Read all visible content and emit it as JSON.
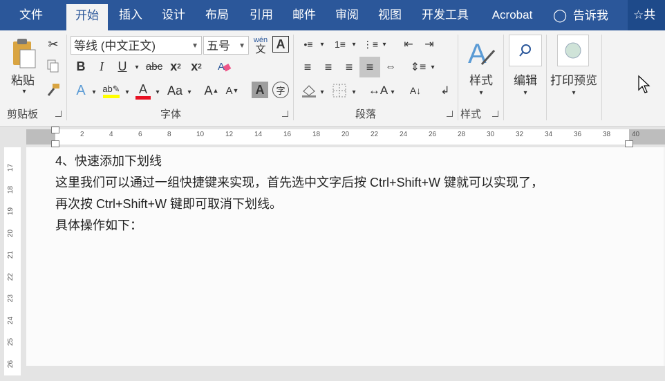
{
  "tabs": [
    "文件",
    "开始",
    "插入",
    "设计",
    "布局",
    "引用",
    "邮件",
    "审阅",
    "视图",
    "开发工具",
    "Acrobat"
  ],
  "active_tab": "开始",
  "tellme": "告诉我",
  "share_label": "共",
  "clipboard": {
    "paste": "粘贴",
    "group": "剪贴板"
  },
  "font": {
    "name": "等线 (中文正文)",
    "size": "五号",
    "wen_top": "wén",
    "wen_bottom": "文",
    "group": "字体",
    "aa": "Aa"
  },
  "paragraph": {
    "group": "段落"
  },
  "styles": {
    "label": "样式",
    "group": "样式"
  },
  "editing": {
    "label": "编辑"
  },
  "print_preview": {
    "label": "打印预览"
  },
  "ruler": {
    "h_numbers": [
      "2",
      "4",
      "6",
      "8",
      "10",
      "12",
      "14",
      "16",
      "18",
      "20",
      "22",
      "24",
      "26",
      "28",
      "30",
      "32",
      "34",
      "36",
      "38",
      "40"
    ],
    "v_numbers": [
      "17",
      "18",
      "19",
      "20",
      "21",
      "22",
      "23",
      "24",
      "25",
      "26"
    ]
  },
  "document": {
    "lines": [
      "4、快速添加下划线",
      "这里我们可以通过一组快捷键来实现，首先选中文字后按 Ctrl+Shift+W 键就可以实现了，",
      "再次按 Ctrl+Shift+W 键即可取消下划线。",
      "具体操作如下："
    ]
  },
  "colors": {
    "accent": "#2b579a",
    "highlight": "#ffff00",
    "font_color": "#e81123"
  }
}
